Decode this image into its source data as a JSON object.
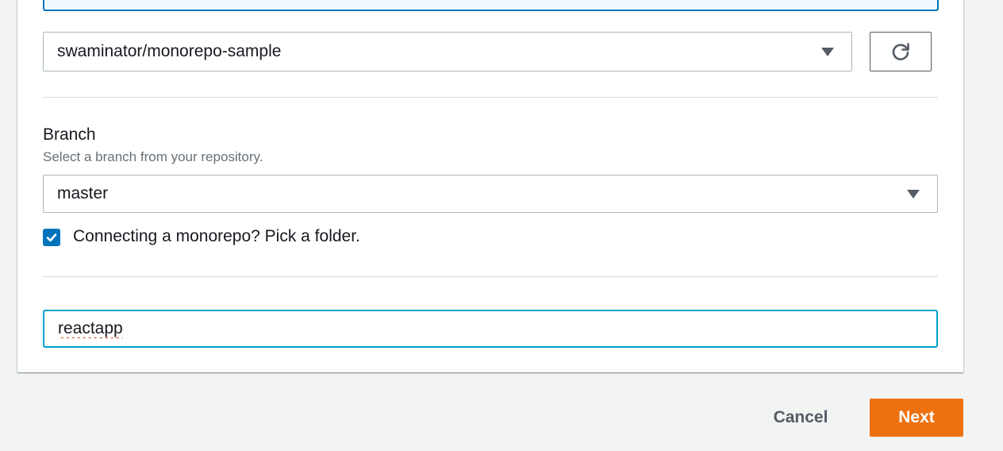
{
  "repository": {
    "selected": "swaminator/monorepo-sample",
    "refresh_icon": "refresh-icon",
    "caret_icon": "caret-down-icon"
  },
  "branch": {
    "label": "Branch",
    "description": "Select a branch from your repository.",
    "selected": "master",
    "caret_icon": "caret-down-icon"
  },
  "monorepo": {
    "checkbox_checked": true,
    "checkbox_label": "Connecting a monorepo? Pick a folder.",
    "folder_value": "reactapp"
  },
  "footer": {
    "cancel_label": "Cancel",
    "next_label": "Next"
  },
  "colors": {
    "accent": "#0073bb",
    "focus": "#00a1c9",
    "primary_button": "#ec7211",
    "background": "#f2f3f3"
  }
}
